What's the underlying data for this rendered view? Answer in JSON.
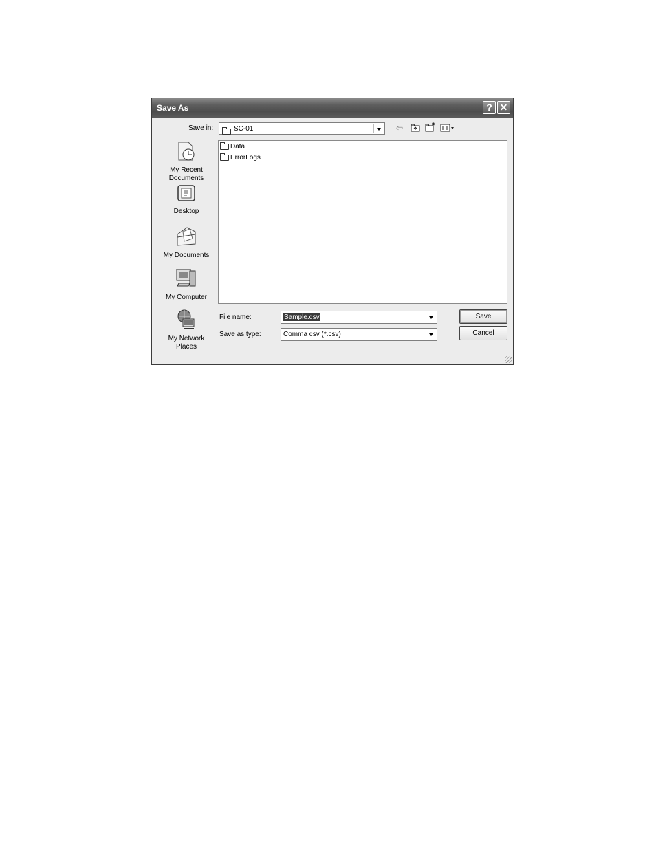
{
  "window": {
    "title": "Save As"
  },
  "titlebar": {
    "help_label": "?",
    "close_label": "✕"
  },
  "save_in": {
    "label": "Save in:",
    "value": "SC-01"
  },
  "toolbar": {
    "icons": [
      "back-icon",
      "up-folder-icon",
      "new-folder-icon",
      "view-menu-icon"
    ]
  },
  "places": [
    {
      "label": "My Recent Documents",
      "icon": "recent-documents-icon"
    },
    {
      "label": "Desktop",
      "icon": "desktop-icon"
    },
    {
      "label": "My Documents",
      "icon": "my-documents-icon"
    },
    {
      "label": "My Computer",
      "icon": "my-computer-icon"
    },
    {
      "label": "My Network Places",
      "icon": "network-places-icon"
    }
  ],
  "files": [
    {
      "name": "Data",
      "type": "folder"
    },
    {
      "name": "ErrorLogs",
      "type": "folder"
    }
  ],
  "file_name": {
    "label": "File name:",
    "value": "Sample.csv"
  },
  "save_as_type": {
    "label": "Save as type:",
    "value": "Comma csv (*.csv)"
  },
  "buttons": {
    "save": "Save",
    "cancel": "Cancel"
  }
}
